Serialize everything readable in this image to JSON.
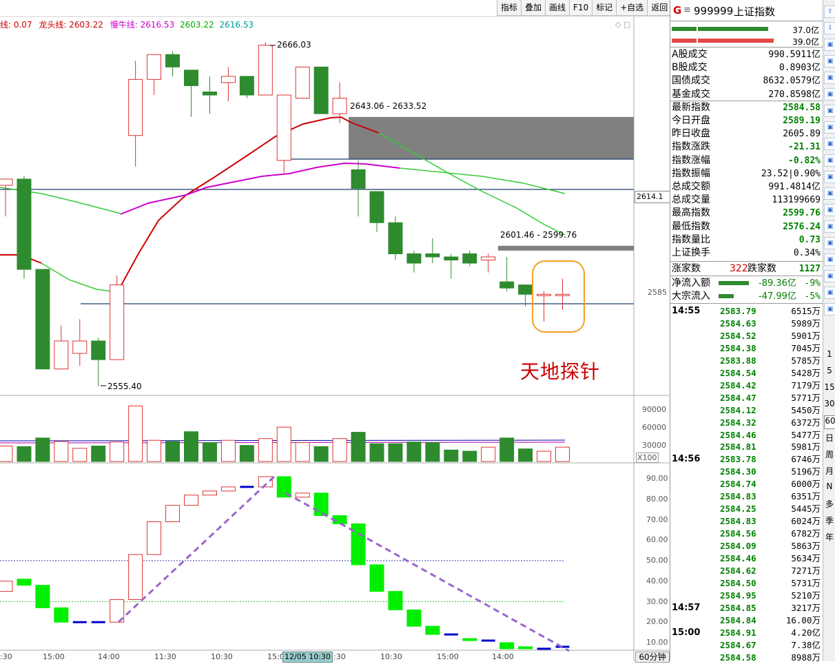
{
  "toolbar": {
    "items": [
      "指标",
      "叠加",
      "画线",
      "F10",
      "标记",
      "+自选",
      "返回"
    ]
  },
  "ma_legend": {
    "prefix": "线: 0.07",
    "dragon_label": "龙头线: 2603.22",
    "bull_label": "慢牛线: 2616.53",
    "val1": "2603.22",
    "val2": "2616.53",
    "colors": {
      "dragon": "#cc0000",
      "bull": "#cc00cc",
      "val1": "#00aa00",
      "val2": "#009999"
    }
  },
  "annotations": {
    "high": "2666.03",
    "low": "2555.40",
    "gap1": "2643.06 - 2633.52",
    "gap2": "2601.46 - 2599.76",
    "caption": "天地探针"
  },
  "price_axis": {
    "current_tag": "2614.1",
    "label_2585": "2585"
  },
  "volume_axis": {
    "ticks": [
      "90000",
      "60000",
      "30000"
    ],
    "unit": "X100"
  },
  "osc_axis": {
    "ticks": [
      "90.00",
      "80.00",
      "70.00",
      "60.00",
      "50.00",
      "40.00",
      "30.00",
      "20.00",
      "10.00"
    ]
  },
  "time_axis": {
    "labels": [
      "15:00",
      "14:00",
      "11:30",
      "10:30",
      "15:00",
      "11:30",
      "10:30",
      "15:00",
      "14:00"
    ],
    "highlight": "12/05 10:30",
    "period": "60分钟",
    "lead": ":30"
  },
  "chart_data": {
    "type": "candlestick",
    "candles": [
      {
        "o": 2622,
        "h": 2622,
        "l": 2610,
        "c": 2620,
        "up": true
      },
      {
        "o": 2622,
        "h": 2623,
        "l": 2590,
        "c": 2593,
        "up": false
      },
      {
        "o": 2593,
        "h": 2593,
        "l": 2561,
        "c": 2561,
        "up": false
      },
      {
        "o": 2561,
        "h": 2575,
        "l": 2561,
        "c": 2570,
        "up": true
      },
      {
        "o": 2566,
        "h": 2577,
        "l": 2562,
        "c": 2570,
        "up": true
      },
      {
        "o": 2570,
        "h": 2571,
        "l": 2555.4,
        "c": 2564,
        "up": false
      },
      {
        "o": 2564,
        "h": 2591,
        "l": 2564,
        "c": 2588,
        "up": true
      },
      {
        "o": 2636,
        "h": 2660,
        "l": 2626,
        "c": 2654,
        "up": true
      },
      {
        "o": 2654,
        "h": 2662,
        "l": 2649,
        "c": 2662,
        "up": true
      },
      {
        "o": 2662,
        "h": 2663,
        "l": 2655,
        "c": 2658,
        "up": false
      },
      {
        "o": 2657,
        "h": 2657,
        "l": 2642,
        "c": 2652,
        "up": false
      },
      {
        "o": 2650,
        "h": 2655,
        "l": 2643,
        "c": 2649,
        "up": false
      },
      {
        "o": 2653,
        "h": 2658,
        "l": 2647,
        "c": 2655,
        "up": true
      },
      {
        "o": 2655,
        "h": 2655,
        "l": 2648,
        "c": 2649,
        "up": false
      },
      {
        "o": 2649,
        "h": 2666.03,
        "l": 2649,
        "c": 2665,
        "up": true
      },
      {
        "o": 2628,
        "h": 2649,
        "l": 2624,
        "c": 2649,
        "up": true
      },
      {
        "o": 2648,
        "h": 2658,
        "l": 2648,
        "c": 2658,
        "up": true
      },
      {
        "o": 2658,
        "h": 2658,
        "l": 2643,
        "c": 2643,
        "up": false
      },
      {
        "o": 2648,
        "h": 2653,
        "l": 2640,
        "c": 2643,
        "up": true
      },
      {
        "o": 2625,
        "h": 2628,
        "l": 2610,
        "c": 2619,
        "up": false
      },
      {
        "o": 2618,
        "h": 2618,
        "l": 2605,
        "c": 2608,
        "up": false
      },
      {
        "o": 2608,
        "h": 2610,
        "l": 2596,
        "c": 2598,
        "up": false
      },
      {
        "o": 2598,
        "h": 2599,
        "l": 2592,
        "c": 2595,
        "up": false
      },
      {
        "o": 2598,
        "h": 2603,
        "l": 2595,
        "c": 2597,
        "up": false
      },
      {
        "o": 2597,
        "h": 2598,
        "l": 2590,
        "c": 2596,
        "up": false
      },
      {
        "o": 2598,
        "h": 2599,
        "l": 2594,
        "c": 2595,
        "up": false
      },
      {
        "o": 2596,
        "h": 2598,
        "l": 2592,
        "c": 2597,
        "up": true
      },
      {
        "o": 2589,
        "h": 2597,
        "l": 2586,
        "c": 2587,
        "up": false
      },
      {
        "o": 2588,
        "h": 2588,
        "l": 2581,
        "c": 2585,
        "up": false
      },
      {
        "o": 2585,
        "h": 2586,
        "l": 2576.2,
        "c": 2585,
        "up": true
      },
      {
        "o": 2585,
        "h": 2590,
        "l": 2580,
        "c": 2585,
        "up": true
      }
    ],
    "volumes": [
      27000,
      26000,
      41000,
      35000,
      23000,
      27000,
      34000,
      97000,
      37000,
      35000,
      52000,
      33000,
      37000,
      28000,
      40000,
      60000,
      33000,
      26000,
      40000,
      51000,
      31000,
      31000,
      34000,
      33000,
      20000,
      18000,
      25000,
      41000,
      22000,
      18000,
      25000
    ],
    "oscillator": [
      {
        "o": 40,
        "c": 35,
        "up": true
      },
      {
        "o": 41,
        "c": 38,
        "up": false
      },
      {
        "o": 38,
        "c": 27,
        "up": false
      },
      {
        "o": 27,
        "c": 20,
        "up": false
      },
      {
        "o": 20,
        "c": 20,
        "up": false,
        "flat": true
      },
      {
        "o": 20,
        "c": 20,
        "up": false,
        "flat": true
      },
      {
        "o": 20,
        "c": 31,
        "up": true
      },
      {
        "o": 31,
        "c": 53,
        "up": true
      },
      {
        "o": 53,
        "c": 69,
        "up": true
      },
      {
        "o": 69,
        "c": 77,
        "up": true
      },
      {
        "o": 77,
        "c": 82,
        "up": true
      },
      {
        "o": 82,
        "c": 84,
        "up": true
      },
      {
        "o": 84,
        "c": 86,
        "up": true
      },
      {
        "o": 86,
        "c": 86,
        "up": false,
        "flat": true
      },
      {
        "o": 86,
        "c": 91,
        "up": true
      },
      {
        "o": 91,
        "c": 81,
        "up": false
      },
      {
        "o": 81,
        "c": 83,
        "up": true
      },
      {
        "o": 83,
        "c": 72,
        "up": false
      },
      {
        "o": 72,
        "c": 68,
        "up": false
      },
      {
        "o": 68,
        "c": 48,
        "up": false
      },
      {
        "o": 48,
        "c": 35,
        "up": false
      },
      {
        "o": 35,
        "c": 26,
        "up": false
      },
      {
        "o": 26,
        "c": 18,
        "up": false
      },
      {
        "o": 18,
        "c": 14,
        "up": false
      },
      {
        "o": 14,
        "c": 14,
        "up": false,
        "flat": true
      },
      {
        "o": 12,
        "c": 11,
        "up": false
      },
      {
        "o": 11,
        "c": 11,
        "up": false,
        "flat": true
      },
      {
        "o": 10,
        "c": 7,
        "up": false
      },
      {
        "o": 8,
        "c": 7,
        "up": false
      },
      {
        "o": 7,
        "c": 7,
        "up": false,
        "flat": true
      },
      {
        "o": 8,
        "c": 8,
        "up": false,
        "flat": true
      }
    ]
  },
  "quote": {
    "code_prefix": "G",
    "code": "999999",
    "name": "上证指数",
    "bars": {
      "buy": "37.0亿",
      "sell": "39.0亿"
    },
    "rows": [
      {
        "k": "A股成交",
        "v": "990.5911亿",
        "color": "#000"
      },
      {
        "k": "B股成交",
        "v": "0.8903亿",
        "color": "#000"
      },
      {
        "k": "国债成交",
        "v": "8632.0579亿",
        "color": "#000"
      },
      {
        "k": "基金成交",
        "v": "270.8598亿",
        "color": "#000"
      },
      {
        "k": "最新指数",
        "v": "2584.58",
        "color": "#008000"
      },
      {
        "k": "今日开盘",
        "v": "2589.19",
        "color": "#008000"
      },
      {
        "k": "昨日收盘",
        "v": "2605.89",
        "color": "#000"
      },
      {
        "k": "指数涨跌",
        "v": "-21.31",
        "color": "#008000"
      },
      {
        "k": "指数涨幅",
        "v": "-0.82%",
        "color": "#008000"
      },
      {
        "k": "指数振幅",
        "v": "23.52|0.90%",
        "color": "#000"
      },
      {
        "k": "总成交额",
        "v": "991.4814亿",
        "color": "#000"
      },
      {
        "k": "总成交量",
        "v": "113199669",
        "color": "#000"
      },
      {
        "k": "最高指数",
        "v": "2599.76",
        "color": "#008000"
      },
      {
        "k": "最低指数",
        "v": "2576.24",
        "color": "#008000"
      },
      {
        "k": "指数量比",
        "v": "0.73",
        "color": "#008000"
      },
      {
        "k": "上证换手",
        "v": "0.34%",
        "color": "#000"
      }
    ],
    "breadth": {
      "up_label": "涨家数",
      "up": "322",
      "down_label": "跌家数",
      "down": "1127"
    },
    "flows": [
      {
        "k": "净流入额",
        "v": "-89.36亿",
        "pct": "-9%"
      },
      {
        "k": "大宗流入",
        "v": "-47.99亿",
        "pct": "-5%"
      }
    ]
  },
  "ticks": [
    {
      "time": "14:55",
      "price": "2583.79",
      "vol": "6515万"
    },
    {
      "time": "",
      "price": "2584.63",
      "vol": "5989万"
    },
    {
      "time": "",
      "price": "2584.52",
      "vol": "5901万"
    },
    {
      "time": "",
      "price": "2584.38",
      "vol": "7045万"
    },
    {
      "time": "",
      "price": "2583.88",
      "vol": "5785万"
    },
    {
      "time": "",
      "price": "2584.54",
      "vol": "5428万"
    },
    {
      "time": "",
      "price": "2584.42",
      "vol": "7179万"
    },
    {
      "time": "",
      "price": "2584.47",
      "vol": "5771万"
    },
    {
      "time": "",
      "price": "2584.12",
      "vol": "5450万"
    },
    {
      "time": "",
      "price": "2584.32",
      "vol": "6372万"
    },
    {
      "time": "",
      "price": "2584.46",
      "vol": "5477万"
    },
    {
      "time": "",
      "price": "2584.81",
      "vol": "5981万"
    },
    {
      "time": "14:56",
      "price": "2583.78",
      "vol": "6746万"
    },
    {
      "time": "",
      "price": "2584.30",
      "vol": "5196万"
    },
    {
      "time": "",
      "price": "2584.74",
      "vol": "6000万"
    },
    {
      "time": "",
      "price": "2584.83",
      "vol": "6351万"
    },
    {
      "time": "",
      "price": "2584.25",
      "vol": "5445万"
    },
    {
      "time": "",
      "price": "2584.83",
      "vol": "6024万"
    },
    {
      "time": "",
      "price": "2584.56",
      "vol": "6782万"
    },
    {
      "time": "",
      "price": "2584.09",
      "vol": "5863万"
    },
    {
      "time": "",
      "price": "2584.46",
      "vol": "5634万"
    },
    {
      "time": "",
      "price": "2584.62",
      "vol": "7271万"
    },
    {
      "time": "",
      "price": "2584.50",
      "vol": "5731万"
    },
    {
      "time": "",
      "price": "2584.95",
      "vol": "5210万"
    },
    {
      "time": "14:57",
      "price": "2584.85",
      "vol": "3217万"
    },
    {
      "time": "",
      "price": "2584.84",
      "vol": "16.00万"
    },
    {
      "time": "15:00",
      "price": "2584.91",
      "vol": "4.20亿"
    },
    {
      "time": "",
      "price": "2584.67",
      "vol": "7.38亿"
    },
    {
      "time": "",
      "price": "2584.58",
      "vol": "8988万"
    }
  ],
  "sidebar": {
    "labels": [
      "1",
      "5",
      "15",
      "30",
      "60",
      "日",
      "周",
      "月",
      "N",
      "多",
      "季",
      "年"
    ]
  }
}
